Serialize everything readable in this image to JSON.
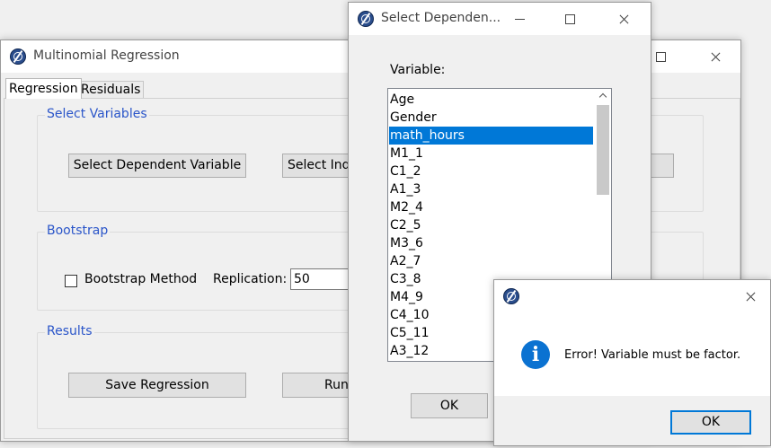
{
  "main_window": {
    "title": "Multinomial Regression",
    "tabs": [
      {
        "label": "Regression"
      },
      {
        "label": "Residuals"
      }
    ],
    "select_variables": {
      "group_label": "Select Variables",
      "dependent_button": "Select Dependent Variable",
      "independent_button": "Select Inde"
    },
    "bootstrap": {
      "group_label": "Bootstrap",
      "method_label": "Bootstrap Method",
      "method_checked": false,
      "replication_label": "Replication:",
      "replication_value": "50"
    },
    "results": {
      "group_label": "Results",
      "save_button": "Save Regression",
      "run_button": "Run"
    }
  },
  "select_dialog": {
    "title": "Select Dependen...",
    "variable_label": "Variable:",
    "variables": [
      "Age",
      "Gender",
      "math_hours",
      "M1_1",
      "C1_2",
      "A1_3",
      "M2_4",
      "C2_5",
      "M3_6",
      "A2_7",
      "C3_8",
      "M4_9",
      "C4_10",
      "C5_11",
      "A3_12"
    ],
    "selected_variable": "math_hours",
    "ok_button": "OK"
  },
  "error_dialog": {
    "message": "Error! Variable must be factor.",
    "ok_button": "OK",
    "icon": "info-icon"
  },
  "colors": {
    "accent": "#0078d7",
    "group_label": "#2a55c9",
    "info_icon": "#0b72d1"
  }
}
